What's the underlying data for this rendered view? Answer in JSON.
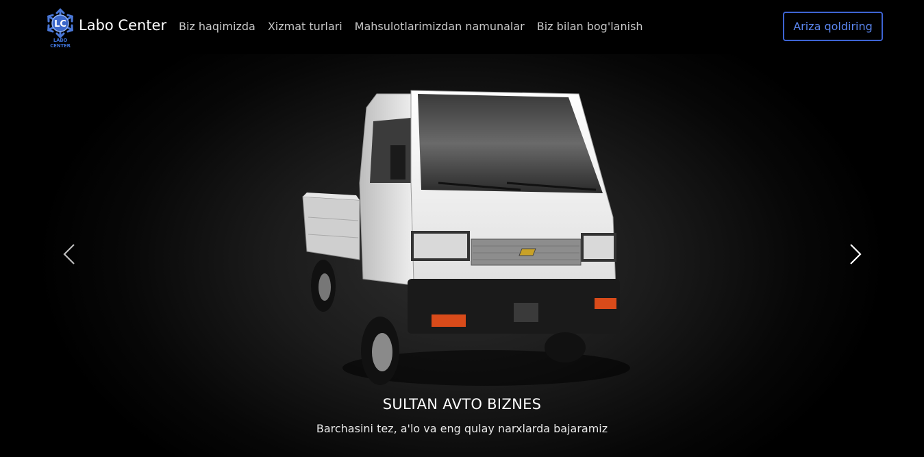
{
  "brand": {
    "name": "Labo Center",
    "logo_text": "LC",
    "logo_caption": "LABO CENTER",
    "logo_color": "#3d6fd1"
  },
  "nav": {
    "links": [
      "Biz haqimizda",
      "Xizmat turlari",
      "Mahsulotlarimizdan namunalar",
      "Biz bilan bog'lanish"
    ],
    "cta_label": "Ariza qoldiring",
    "cta_color": "#3e64d4"
  },
  "hero": {
    "image": "white-labo-truck",
    "title": "SULTAN AVTO BIZNES",
    "subtitle": "Barchasini tez, a'lo va eng qulay narxlarda bajaramiz",
    "prev_icon": "chevron-left-icon",
    "next_icon": "chevron-right-icon"
  }
}
